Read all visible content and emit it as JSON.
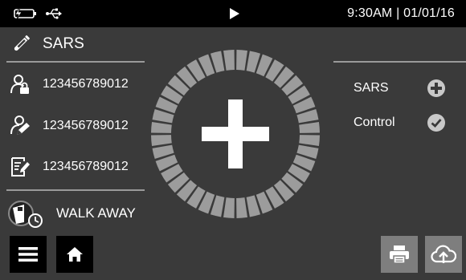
{
  "status_bar": {
    "datetime": "9:30AM | 01/01/16",
    "icons": [
      "battery-charging-icon",
      "usb-icon",
      "play-icon"
    ]
  },
  "test": {
    "icon": "test-tube-icon",
    "name": "SARS"
  },
  "identifiers": [
    {
      "icon": "patient-id-icon",
      "value": "123456789012"
    },
    {
      "icon": "operator-id-icon",
      "value": "123456789012"
    },
    {
      "icon": "sample-note-icon",
      "value": "123456789012"
    }
  ],
  "mode": {
    "icon": "walk-away-icon",
    "label": "WALK AWAY"
  },
  "center": {
    "icon": "plus-icon",
    "ring_segments": 40
  },
  "results": [
    {
      "label": "SARS",
      "icon": "positive-plus-icon"
    },
    {
      "label": "Control",
      "icon": "valid-check-icon"
    }
  ],
  "toolbar": {
    "left": [
      "menu-icon",
      "home-icon"
    ],
    "right": [
      "print-icon",
      "cloud-upload-icon"
    ]
  },
  "colors": {
    "background": "#3a3a3a",
    "status_bar": "#000000",
    "ring_segment": "#9c9c9c",
    "result_icon": "#c8c8c8",
    "button_dark": "#000000",
    "button_grey": "#7e7e7e"
  }
}
